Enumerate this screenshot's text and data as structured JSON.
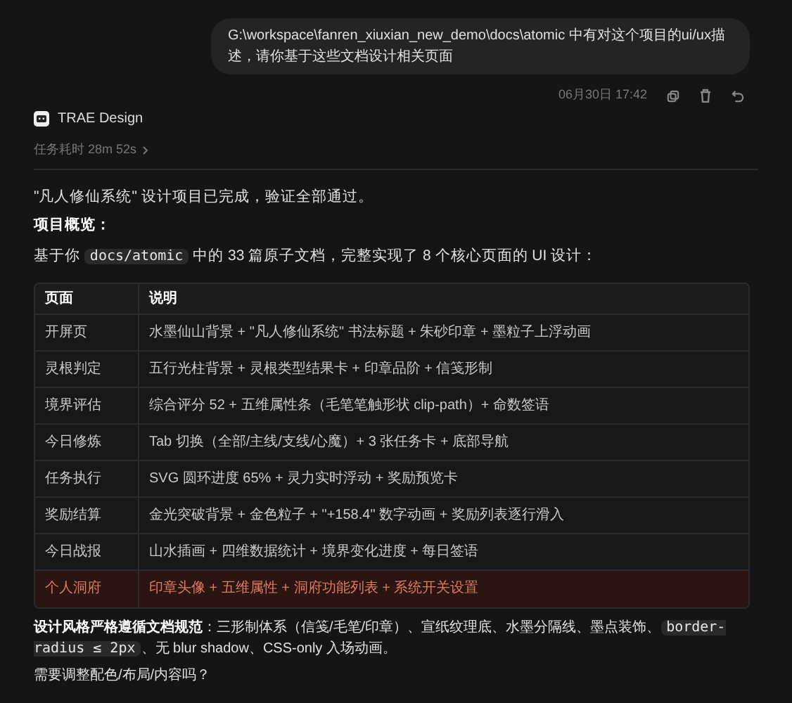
{
  "user_message": {
    "text": "G:\\workspace\\fanren_xiuxian_new_demo\\docs\\atomic 中有对这个项目的ui/ux描述，请你基于这些文档设计相关页面",
    "timestamp": "06月30日 17:42"
  },
  "assistant": {
    "name": "TRAE Design",
    "task_time": "任务耗时 28m 52s",
    "task_time_expanded": false
  },
  "status_line": "\"凡人修仙系统\" 设计项目已完成，验证全部通过。",
  "overview_heading": "项目概览：",
  "overview": [
    {
      "kind": "text",
      "text": "基于你 "
    },
    {
      "kind": "code",
      "text": "docs/atomic"
    },
    {
      "kind": "text",
      "text": " 中的 33 篇原子文档，完整实现了 8 个核心页面的 UI 设计："
    }
  ],
  "table": {
    "columns": [
      "页面",
      "说明"
    ],
    "rows": [
      {
        "page": "开屏页",
        "description": "水墨仙山背景 + \"凡人修仙系统\" 书法标题 + 朱砂印章 + 墨粒子上浮动画",
        "highlighted": false
      },
      {
        "page": "灵根判定",
        "description": "五行光柱背景 + 灵根类型结果卡 + 印章品阶 + 信笺形制",
        "highlighted": false
      },
      {
        "page": "境界评估",
        "description": "综合评分 52 + 五维属性条（毛笔笔触形状 clip-path）+ 命数签语",
        "highlighted": false
      },
      {
        "page": "今日修炼",
        "description": "Tab 切换（全部/主线/支线/心魔）+ 3 张任务卡 + 底部导航",
        "highlighted": false
      },
      {
        "page": "任务执行",
        "description": "SVG 圆环进度 65% + 灵力实时浮动 + 奖励预览卡",
        "highlighted": false
      },
      {
        "page": "奖励结算",
        "description": "金光突破背景 + 金色粒子 + \"+158.4\" 数字动画 + 奖励列表逐行滑入",
        "highlighted": false
      },
      {
        "page": "今日战报",
        "description": "山水插画 + 四维数据统计 + 境界变化进度 + 每日签语",
        "highlighted": false
      },
      {
        "page": "个人洞府",
        "description": "印章头像 + 五维属性 + 洞府功能列表 + 系统开关设置",
        "highlighted": true
      }
    ]
  },
  "design_note": [
    {
      "kind": "bold",
      "text": "设计风格严格遵循文档规范"
    },
    {
      "kind": "text",
      "text": "：三形制体系（信笺/毛笔/印章）、宣纸纹理底、水墨分隔线、墨点装饰、"
    },
    {
      "kind": "code",
      "text": "border-radius ≤ 2px"
    },
    {
      "kind": "text",
      "text": "、无 blur shadow、CSS-only 入场动画。"
    }
  ],
  "question": "需要调整配色/布局/内容吗？"
}
